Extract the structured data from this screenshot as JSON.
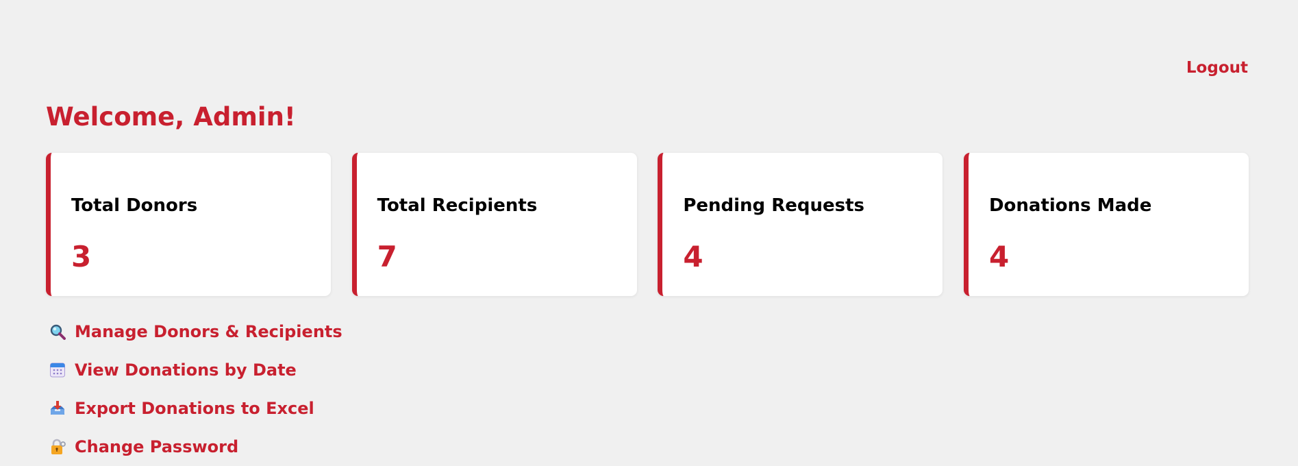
{
  "header": {
    "logout_label": "Logout",
    "welcome": "Welcome, Admin!"
  },
  "stats": [
    {
      "title": "Total Donors",
      "value": "3"
    },
    {
      "title": "Total Recipients",
      "value": "7"
    },
    {
      "title": "Pending Requests",
      "value": "4"
    },
    {
      "title": "Donations Made",
      "value": "4"
    }
  ],
  "links": [
    {
      "icon": "magnifying-glass-icon",
      "label": "Manage Donors & Recipients"
    },
    {
      "icon": "calendar-icon",
      "label": "View Donations by Date"
    },
    {
      "icon": "inbox-download-icon",
      "label": "Export Donations to Excel"
    },
    {
      "icon": "lock-with-key-icon",
      "label": "Change Password"
    }
  ],
  "colors": {
    "accent": "#c8202f",
    "background": "#f0f0f0",
    "card": "#ffffff"
  }
}
